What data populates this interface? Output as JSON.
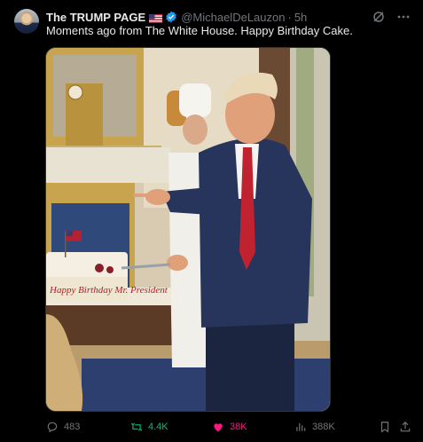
{
  "post": {
    "author_name": "The TRUMP PAGE",
    "handle": "@MichaelDeLauzon",
    "separator": "·",
    "time": "5h",
    "text": "Moments ago from The White House. Happy Birthday Cake."
  },
  "media": {
    "cake_lettering": "Happy Birthday Mr. President"
  },
  "actions": {
    "replies": "483",
    "reposts": "4.4K",
    "likes": "38K",
    "views": "388K"
  },
  "colors": {
    "background": "#000000",
    "text": "#e7e9ea",
    "muted": "#71767b",
    "verified": "#1d9bf0",
    "repost_active": "#00ba7c",
    "like_active": "#f91880"
  },
  "icons": {
    "verified": "verified-badge-icon",
    "flag": "us-flag-icon",
    "grok": "grok-icon",
    "more": "more-icon",
    "reply": "reply-icon",
    "repost": "repost-icon",
    "like": "heart-icon",
    "views": "views-icon",
    "bookmark": "bookmark-icon",
    "share": "share-icon"
  }
}
